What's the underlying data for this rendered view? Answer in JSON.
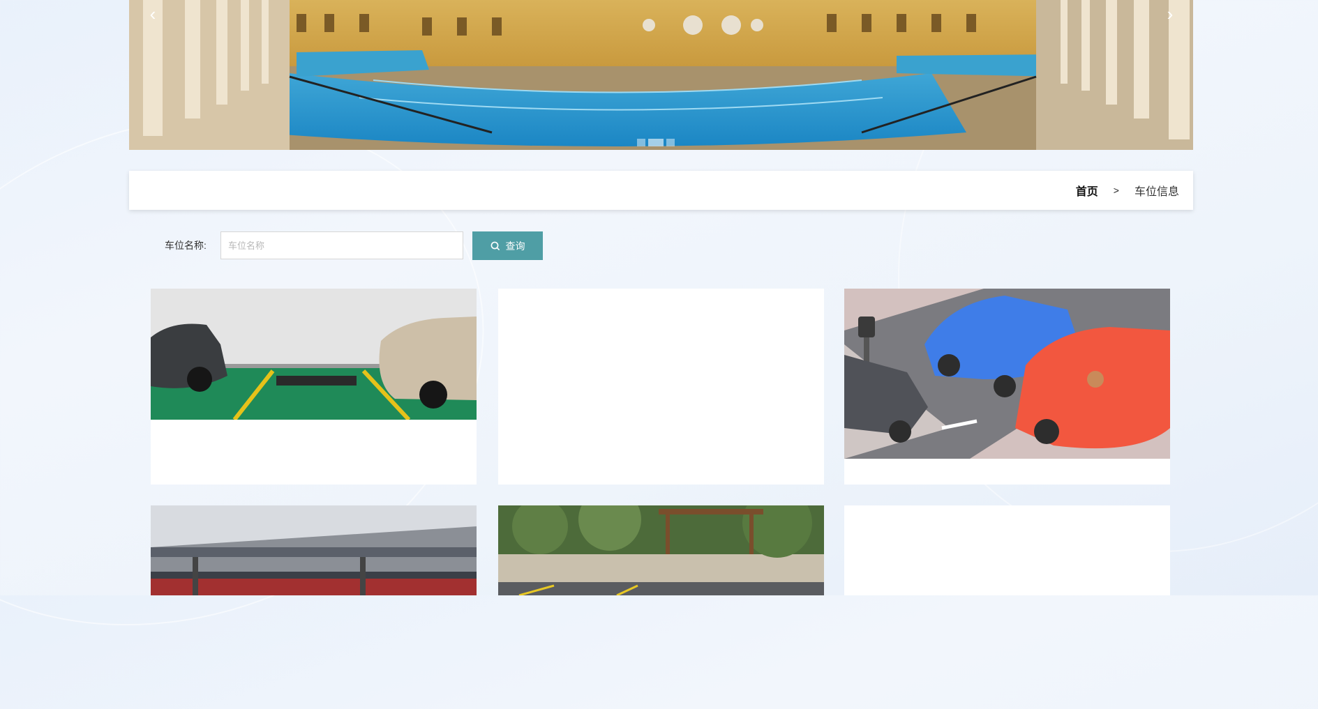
{
  "banner": {
    "prev_icon": "chevron-left-icon",
    "next_icon": "chevron-right-icon",
    "slide_count": 3,
    "active_slide": 1
  },
  "breadcrumb": {
    "home": "首页",
    "separator": ">",
    "current": "车位信息"
  },
  "search": {
    "label": "车位名称:",
    "placeholder": "车位名称",
    "value": "",
    "button_label": "查询",
    "button_icon": "search-icon"
  },
  "colors": {
    "accent": "#4f9ea5",
    "page_bg": "#eef4fb"
  },
  "cards": [
    {
      "image": "parking-garage-photo"
    },
    {
      "image": "blank"
    },
    {
      "image": "cartoon-cars-illustration"
    },
    {
      "image": "mechanical-parking-photo"
    },
    {
      "image": "outdoor-parking-photo"
    },
    {
      "image": "blank"
    }
  ]
}
